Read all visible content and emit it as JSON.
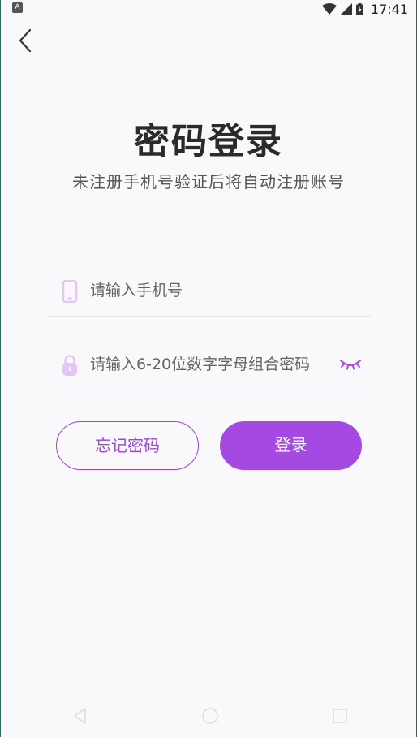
{
  "status_bar": {
    "app_icon_letter": "A",
    "time": "17:41",
    "icons": [
      "wifi-icon",
      "signal-icon",
      "battery-icon"
    ]
  },
  "header": {
    "back_icon": "chevron-left-icon"
  },
  "title": "密码登录",
  "subtitle": "未注册手机号验证后将自动注册账号",
  "form": {
    "phone": {
      "icon": "phone-icon",
      "value": "",
      "placeholder": "请输入手机号"
    },
    "password": {
      "icon": "lock-icon",
      "value": "",
      "placeholder": "请输入6-20位数字字母组合密码",
      "toggle_icon": "eye-closed-icon"
    }
  },
  "buttons": {
    "forgot_label": "忘记密码",
    "login_label": "登录"
  },
  "nav_bar": {
    "icons": [
      "nav-back-icon",
      "nav-home-icon",
      "nav-recent-icon"
    ]
  },
  "colors": {
    "accent": "#a44ae2",
    "icon_tint": "#e2c6f3",
    "background": "#f9f9fb"
  }
}
